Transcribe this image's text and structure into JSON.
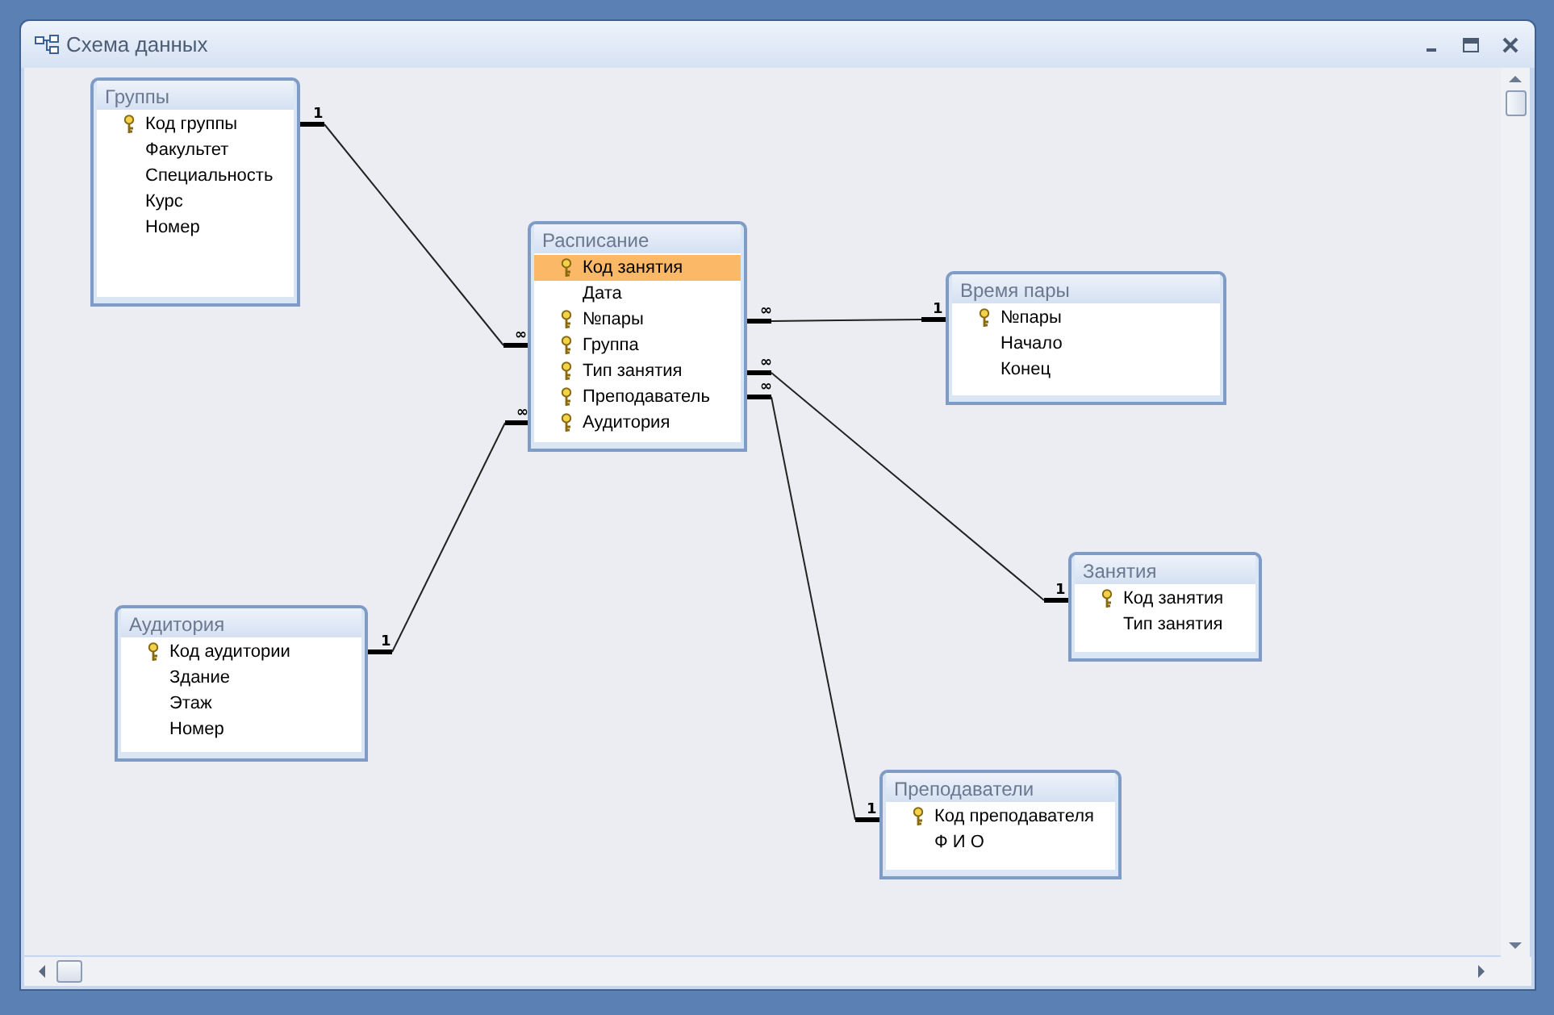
{
  "window": {
    "title": "Схема данных"
  },
  "tables": [
    {
      "title": "Группы",
      "fields": [
        {
          "name": "Код группы",
          "key": true,
          "selected": false
        },
        {
          "name": "Факультет",
          "key": false,
          "selected": false
        },
        {
          "name": "Специальность",
          "key": false,
          "selected": false
        },
        {
          "name": "Курс",
          "key": false,
          "selected": false
        },
        {
          "name": "Номер",
          "key": false,
          "selected": false
        }
      ]
    },
    {
      "title": "Расписание",
      "fields": [
        {
          "name": "Код занятия",
          "key": true,
          "selected": true
        },
        {
          "name": "Дата",
          "key": false,
          "selected": false
        },
        {
          "name": "№пары",
          "key": true,
          "selected": false
        },
        {
          "name": "Группа",
          "key": true,
          "selected": false
        },
        {
          "name": "Тип занятия",
          "key": true,
          "selected": false
        },
        {
          "name": "Преподаватель",
          "key": true,
          "selected": false
        },
        {
          "name": "Аудитория",
          "key": true,
          "selected": false
        }
      ]
    },
    {
      "title": "Время пары",
      "fields": [
        {
          "name": "№пары",
          "key": true,
          "selected": false
        },
        {
          "name": "Начало",
          "key": false,
          "selected": false
        },
        {
          "name": "Конец",
          "key": false,
          "selected": false
        }
      ]
    },
    {
      "title": "Занятия",
      "fields": [
        {
          "name": "Код занятия",
          "key": true,
          "selected": false
        },
        {
          "name": "Тип занятия",
          "key": false,
          "selected": false
        }
      ]
    },
    {
      "title": "Аудитория",
      "fields": [
        {
          "name": "Код аудитории",
          "key": true,
          "selected": false
        },
        {
          "name": "Здание",
          "key": false,
          "selected": false
        },
        {
          "name": "Этаж",
          "key": false,
          "selected": false
        },
        {
          "name": "Номер",
          "key": false,
          "selected": false
        }
      ]
    },
    {
      "title": "Преподаватели",
      "fields": [
        {
          "name": "Код преподавателя",
          "key": true,
          "selected": false
        },
        {
          "name": "Ф И О",
          "key": false,
          "selected": false
        }
      ]
    }
  ],
  "relationships": [
    {
      "one_label": "1",
      "many_label": "∞"
    },
    {
      "one_label": "1",
      "many_label": "∞"
    },
    {
      "one_label": "1",
      "many_label": "∞"
    },
    {
      "one_label": "1",
      "many_label": "∞"
    },
    {
      "one_label": "1",
      "many_label": "∞"
    }
  ]
}
